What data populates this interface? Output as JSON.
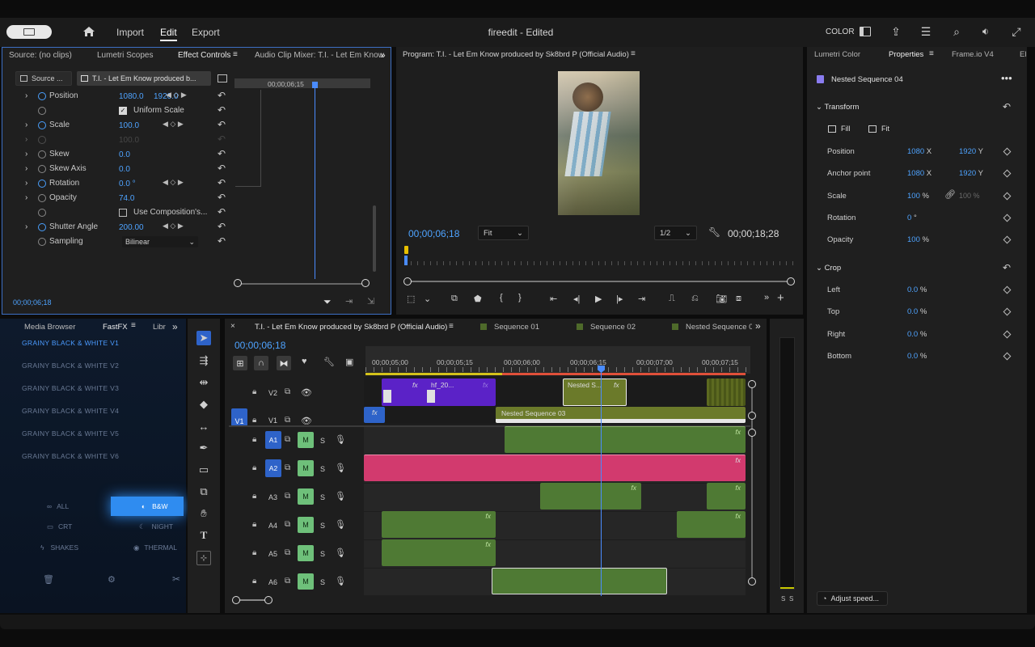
{
  "topbar": {
    "nav": [
      "Import",
      "Edit",
      "Export"
    ],
    "active_nav": "Edit",
    "title": "fireedit - Edited",
    "color_label": "COLOR"
  },
  "source_panel": {
    "tabs": [
      "Source: (no clips)",
      "Lumetri Scopes",
      "Effect Controls",
      "Audio Clip Mixer: T.I. - Let Em Know",
      "»"
    ],
    "active_tab": "Effect Controls",
    "source_chip": "Source ...",
    "clip_chip": "T.I. - Let Em Know produced b...",
    "ruler_time": "00;00;06;15",
    "position_label": "Position",
    "position_x": "1080.0",
    "position_y": "1920.0",
    "uniform_scale": "Uniform Scale",
    "scale_label": "Scale",
    "scale_value": "100.0",
    "scale_width": "100.0",
    "skew_label": "Skew",
    "skew_value": "0.0",
    "skew_axis_label": "Skew Axis",
    "skew_axis_value": "0.0",
    "rotation_label": "Rotation",
    "rotation_value": "0.0 °",
    "opacity_label": "Opacity",
    "opacity_value": "74.0",
    "use_comp_label": "Use Composition's...",
    "shutter_label": "Shutter Angle",
    "shutter_value": "200.00",
    "sampling_label": "Sampling",
    "sampling_value": "Bilinear",
    "timecode": "00;00;06;18"
  },
  "program": {
    "title": "Program: T.I. - Let Em Know produced by Sk8brd P (Official Audio)",
    "timecode": "00;00;06;18",
    "fit": "Fit",
    "resolution": "1/2",
    "duration": "00;00;18;28"
  },
  "properties": {
    "tabs": [
      "Lumetri Color",
      "Properties",
      "Frame.io V4",
      "El"
    ],
    "active_tab": "Properties",
    "object_name": "Nested Sequence 04",
    "transform_label": "Transform",
    "fill_label": "Fill",
    "fit_label": "Fit",
    "position_label": "Position",
    "position_x": "1080",
    "position_y": "1920",
    "anchor_label": "Anchor point",
    "anchor_x": "1080",
    "anchor_y": "1920",
    "scale_label": "Scale",
    "scale_value": "100",
    "scale_pct": "%",
    "scale_h": "100",
    "rotation_label": "Rotation",
    "rotation_value": "0",
    "opacity_label": "Opacity",
    "opacity_value": "100",
    "crop_label": "Crop",
    "left_label": "Left",
    "top_label": "Top",
    "right_label": "Right",
    "bottom_label": "Bottom",
    "crop_value": "0.0",
    "x_unit": "X",
    "y_unit": "Y",
    "pct_unit": "%",
    "deg_unit": "°",
    "adjust_speed": "Adjust speed..."
  },
  "fastfx": {
    "tabs": [
      "Media Browser",
      "FastFX",
      "Libr",
      "»"
    ],
    "active_tab": "FastFX",
    "items": [
      "GRAINY BLACK & WHITE V1",
      "GRAINY BLACK & WHITE V2",
      "GRAINY BLACK & WHITE V3",
      "GRAINY BLACK & WHITE V4",
      "GRAINY BLACK & WHITE V5",
      "GRAINY BLACK & WHITE V6"
    ],
    "filters": {
      "all": "ALL",
      "bw": "B&W",
      "crt": "CRT",
      "night": "NIGHT",
      "shakes": "SHAKES",
      "thermal": "THERMAL"
    }
  },
  "timeline": {
    "tabs": [
      "T.I. - Let Em Know produced by Sk8brd P (Official Audio)",
      "Sequence 01",
      "Sequence 02",
      "Nested Sequence 0",
      "»"
    ],
    "timecode": "00;00;06;18",
    "ruler": [
      "00;00;05;00",
      "00;00;05;15",
      "00;00;06;00",
      "00;00;06;15",
      "00;00;07;00",
      "00;00;07;15"
    ],
    "video_tracks": [
      "V2",
      "V1"
    ],
    "v1_source": "V1",
    "audio_tracks": [
      "A1",
      "A2",
      "A3",
      "A4",
      "A5",
      "A6"
    ],
    "mute": "M",
    "solo": "S",
    "clips": {
      "hf": "hf_20...",
      "nested_s": "Nested S...",
      "nested03": "Nested Sequence 03",
      "fx": "fx"
    },
    "meter_labels": [
      "S",
      "S"
    ]
  },
  "colors": {
    "accent": "#2e63c9",
    "audio_clip": "#4f7a34",
    "pink_clip": "#d23a6e",
    "v2_clip": "#5b22c7",
    "nested_clip": "#6b7a2a",
    "playhead": "#4a8cff"
  }
}
